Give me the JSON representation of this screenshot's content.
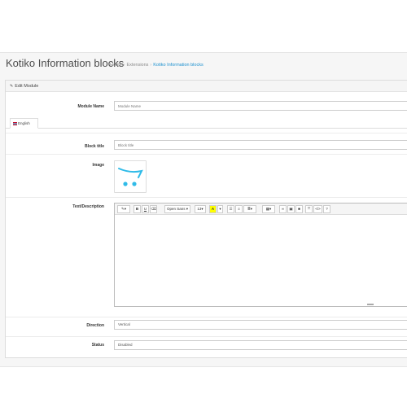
{
  "header": {
    "title": "Kotiko Information blocks",
    "breadcrumb": [
      "Home",
      "Extensions",
      "Kotiko Information blocks"
    ]
  },
  "panel": {
    "heading": "Edit Module"
  },
  "form": {
    "module_name": {
      "label": "Module Name",
      "placeholder": "Module Name"
    },
    "tab": {
      "label": "English"
    },
    "block_title": {
      "label": "Block title",
      "placeholder": "Block title"
    },
    "image": {
      "label": "Image",
      "icon": "cart-logo-icon"
    },
    "text": {
      "label": "Text/Description",
      "toolbar": {
        "font": "Open Sans",
        "size": "13",
        "color_label": "A",
        "bold": "B",
        "underline": "U",
        "help": "?"
      }
    },
    "direction": {
      "label": "Direction",
      "value": "Vertical"
    },
    "status": {
      "label": "Status",
      "value": "Disabled"
    }
  },
  "colors": {
    "accent": "#1e91cf",
    "logo": "#30bbe8"
  }
}
